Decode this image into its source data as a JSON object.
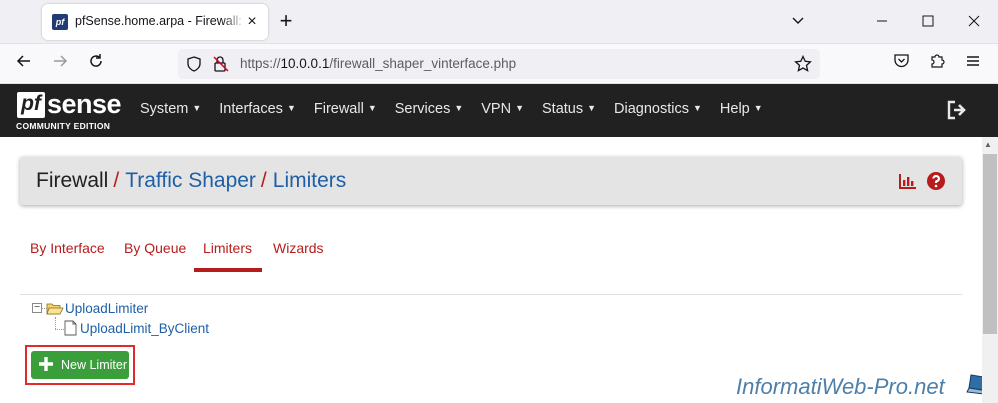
{
  "browser": {
    "tab_title": "pfSense.home.arpa - Firewall: Traffic Shaper: Limiters",
    "tab_favicon_text": "pf",
    "tab_close": "×",
    "new_tab": "+",
    "url_prefix": "https://",
    "url_host": "10.0.0.1",
    "url_path": "/firewall_shaper_vinterface.php"
  },
  "logo": {
    "pf": "pf",
    "sense": "sense",
    "subtitle": "COMMUNITY EDITION"
  },
  "menu": [
    {
      "label": "System"
    },
    {
      "label": "Interfaces"
    },
    {
      "label": "Firewall"
    },
    {
      "label": "Services"
    },
    {
      "label": "VPN"
    },
    {
      "label": "Status"
    },
    {
      "label": "Diagnostics"
    },
    {
      "label": "Help"
    }
  ],
  "breadcrumb": {
    "first": "Firewall",
    "sep": "/",
    "second": "Traffic Shaper",
    "third": "Limiters"
  },
  "tabs": [
    {
      "label": "By Interface"
    },
    {
      "label": "By Queue"
    },
    {
      "label": "Limiters"
    },
    {
      "label": "Wizards"
    }
  ],
  "tree": {
    "expander": "−",
    "root": "UploadLimiter",
    "child": "UploadLimit_ByClient"
  },
  "new_button_label": "New Limiter",
  "watermark": "InformatiWeb-Pro.net",
  "colors": {
    "header_bg": "#212121",
    "accent_red": "#b71c1c",
    "link_blue": "#1e5fa8",
    "button_green": "#3a9f3a",
    "highlight_frame": "#e12b2b"
  }
}
